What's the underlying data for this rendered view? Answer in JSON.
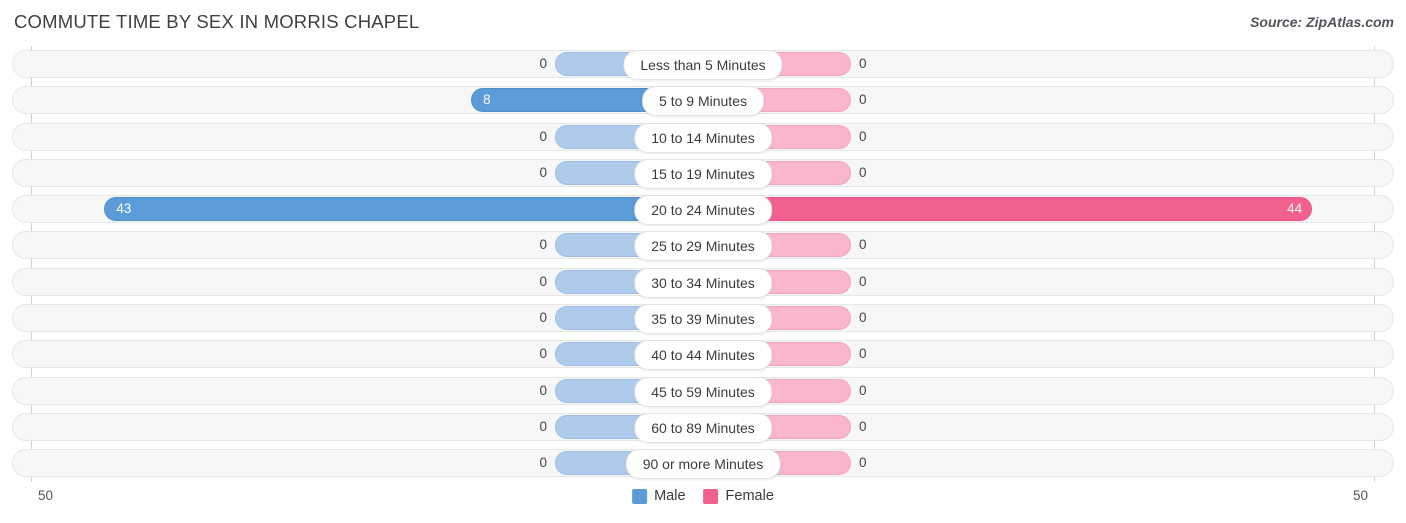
{
  "header": {
    "title": "COMMUTE TIME BY SEX IN MORRIS CHAPEL",
    "source": "Source: ZipAtlas.com"
  },
  "legend": {
    "male_label": "Male",
    "female_label": "Female",
    "male_color": "#5b9bd8",
    "female_color": "#f2618e"
  },
  "axis": {
    "left_tick": "50",
    "right_tick": "50",
    "max": 50
  },
  "chart_data": {
    "type": "bar",
    "title": "COMMUTE TIME BY SEX IN MORRIS CHAPEL",
    "subtitle": "Source: ZipAtlas.com",
    "orientation": "horizontal-diverging",
    "xlabel": "",
    "ylabel": "",
    "xlim": [
      50,
      50
    ],
    "grid": false,
    "legend_position": "bottom-center",
    "categories": [
      "Less than 5 Minutes",
      "5 to 9 Minutes",
      "10 to 14 Minutes",
      "15 to 19 Minutes",
      "20 to 24 Minutes",
      "25 to 29 Minutes",
      "30 to 34 Minutes",
      "35 to 39 Minutes",
      "40 to 44 Minutes",
      "45 to 59 Minutes",
      "60 to 89 Minutes",
      "90 or more Minutes"
    ],
    "series": [
      {
        "name": "Male",
        "color": "#5b9bd8",
        "values": [
          0,
          8,
          0,
          0,
          43,
          0,
          0,
          0,
          0,
          0,
          0,
          0
        ]
      },
      {
        "name": "Female",
        "color": "#f2618e",
        "values": [
          0,
          0,
          0,
          0,
          44,
          0,
          0,
          0,
          0,
          0,
          0,
          0
        ]
      }
    ]
  },
  "rows": [
    {
      "label": "Less than 5 Minutes",
      "male": "0",
      "female": "0"
    },
    {
      "label": "5 to 9 Minutes",
      "male": "8",
      "female": "0"
    },
    {
      "label": "10 to 14 Minutes",
      "male": "0",
      "female": "0"
    },
    {
      "label": "15 to 19 Minutes",
      "male": "0",
      "female": "0"
    },
    {
      "label": "20 to 24 Minutes",
      "male": "43",
      "female": "44"
    },
    {
      "label": "25 to 29 Minutes",
      "male": "0",
      "female": "0"
    },
    {
      "label": "30 to 34 Minutes",
      "male": "0",
      "female": "0"
    },
    {
      "label": "35 to 39 Minutes",
      "male": "0",
      "female": "0"
    },
    {
      "label": "40 to 44 Minutes",
      "male": "0",
      "female": "0"
    },
    {
      "label": "45 to 59 Minutes",
      "male": "0",
      "female": "0"
    },
    {
      "label": "60 to 89 Minutes",
      "male": "0",
      "female": "0"
    },
    {
      "label": "90 or more Minutes",
      "male": "0",
      "female": "0"
    }
  ]
}
